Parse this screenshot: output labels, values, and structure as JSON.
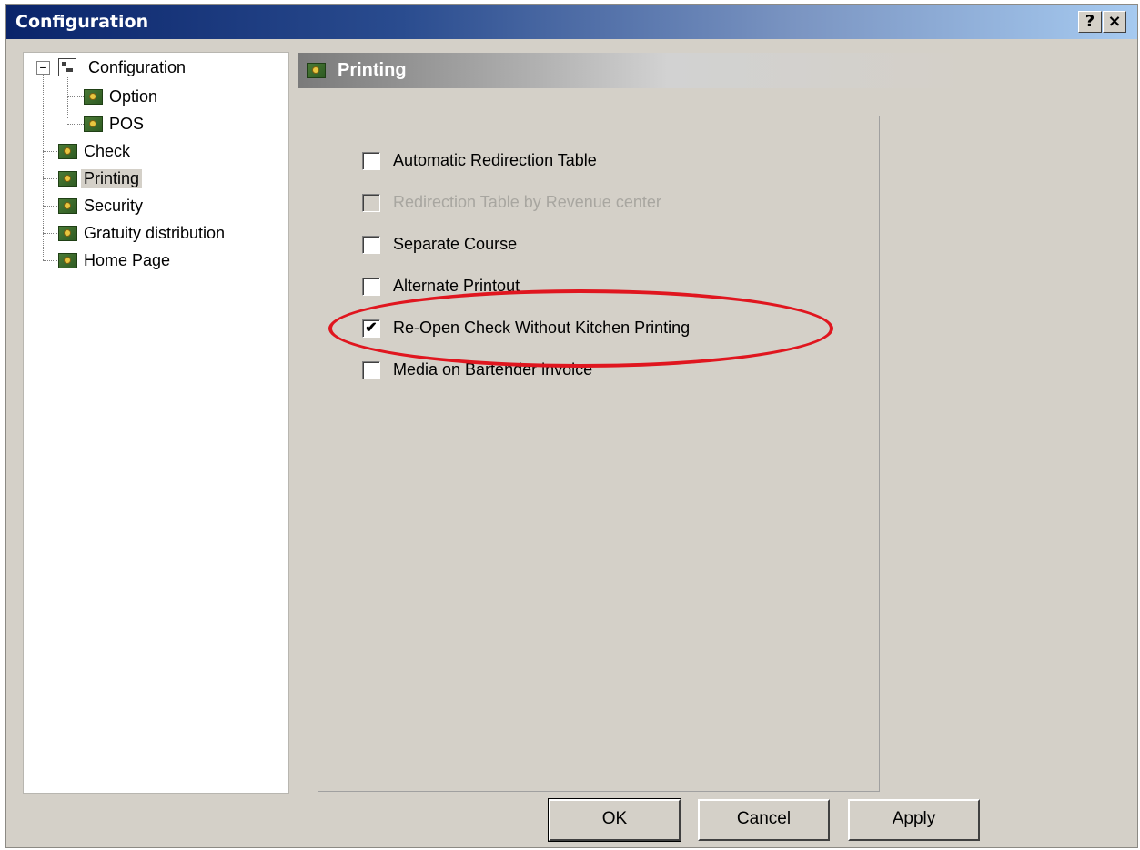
{
  "window": {
    "title": "Configuration",
    "help_label": "?",
    "close_label": "×"
  },
  "tree": {
    "items": [
      {
        "label": "Configuration",
        "icon": "config-tree-icon",
        "expander": "−"
      },
      {
        "label": "Option",
        "icon": "gear-folder-icon"
      },
      {
        "label": "POS",
        "icon": "gear-folder-icon"
      },
      {
        "label": "Check",
        "icon": "gear-folder-icon"
      },
      {
        "label": "Printing",
        "icon": "gear-folder-icon",
        "selected": true
      },
      {
        "label": "Security",
        "icon": "gear-folder-icon"
      },
      {
        "label": "Gratuity distribution",
        "icon": "gear-folder-icon"
      },
      {
        "label": "Home Page",
        "icon": "gear-folder-icon"
      }
    ]
  },
  "panel": {
    "title": "Printing",
    "icon": "gear-folder-icon",
    "options": [
      {
        "label": "Automatic Redirection Table",
        "checked": false,
        "enabled": true
      },
      {
        "label": "Redirection Table by Revenue center",
        "checked": false,
        "enabled": false
      },
      {
        "label": "Separate Course",
        "checked": false,
        "enabled": true
      },
      {
        "label": "Alternate Printout",
        "checked": false,
        "enabled": true
      },
      {
        "label": "Re-Open Check Without Kitchen Printing",
        "checked": true,
        "enabled": true,
        "highlighted": true
      },
      {
        "label": "Media on Bartender invoice",
        "checked": false,
        "enabled": true
      }
    ],
    "check_mark": "✔"
  },
  "buttons": {
    "ok": "OK",
    "cancel": "Cancel",
    "apply": "Apply"
  },
  "colors": {
    "title_bar": "#0a246a",
    "dialog_face": "#d4d0c8",
    "highlight_ellipse": "#e0161f"
  }
}
